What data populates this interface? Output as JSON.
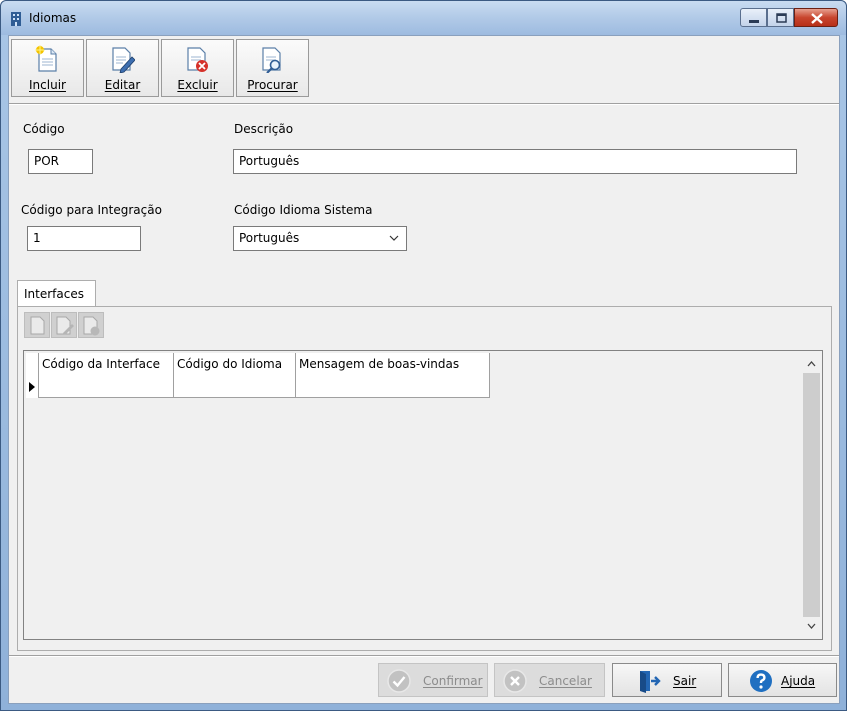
{
  "window": {
    "title": "Idiomas"
  },
  "toolbar": {
    "incluir": "Incluir",
    "editar": "Editar",
    "excluir": "Excluir",
    "procurar": "Procurar"
  },
  "form": {
    "codigo_label": "Código",
    "codigo_value": "POR",
    "descricao_label": "Descrição",
    "descricao_value": "Português",
    "integracao_label": "Código para Integração",
    "integracao_value": "1",
    "idioma_sistema_label": "Código Idioma Sistema",
    "idioma_sistema_value": "Português"
  },
  "tabs": {
    "interfaces": "Interfaces"
  },
  "grid": {
    "columns": [
      "Código da Interface",
      "Código do Idioma",
      "Mensagem de boas-vindas"
    ]
  },
  "buttons": {
    "confirmar": "Confirmar",
    "cancelar": "Cancelar",
    "sair": "Sair",
    "ajuda": "Ajuda"
  },
  "colors": {
    "title_gradient": "#b3cbe8",
    "client_bg": "#f0f0f0",
    "help_blue": "#1f6fc1",
    "close_red": "#c8452e"
  }
}
